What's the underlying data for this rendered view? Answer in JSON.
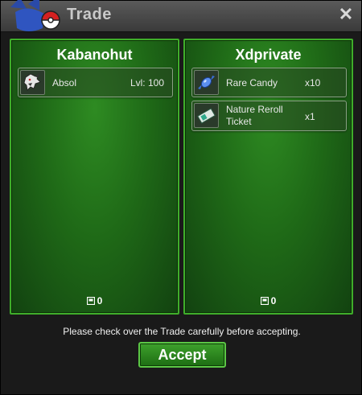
{
  "window": {
    "title": "Trade"
  },
  "left_panel": {
    "player": "Kabanohut",
    "items": [
      {
        "name": "Absol",
        "qty": "Lvl: 100",
        "icon": "absol-sprite-icon"
      }
    ],
    "money": "0"
  },
  "right_panel": {
    "player": "Xdprivate",
    "items": [
      {
        "name": "Rare Candy",
        "qty": "x10",
        "icon": "rare-candy-icon"
      },
      {
        "name": "Nature Reroll Ticket",
        "name_line1": "Nature Reroll",
        "name_line2": "Ticket",
        "qty": "x1",
        "icon": "ticket-icon"
      }
    ],
    "money": "0"
  },
  "footer": {
    "notice": "Please check over the Trade carefully before accepting.",
    "accept_label": "Accept"
  },
  "colors": {
    "panel_green": "#1f6a17",
    "panel_border": "#3fae2a",
    "accept_green": "#2e8a20"
  }
}
